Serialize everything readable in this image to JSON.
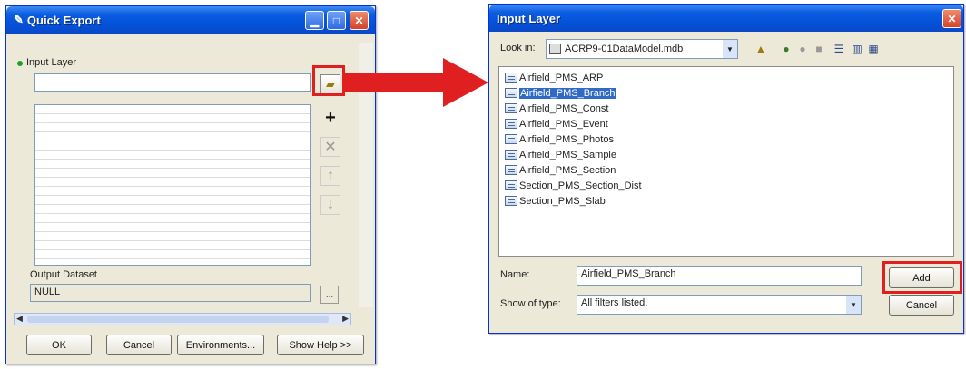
{
  "quick_export": {
    "title": "Quick Export",
    "input_layer_label": "Input Layer",
    "input_layer_value": "",
    "output_dataset_label": "Output Dataset",
    "output_dataset_value": "NULL",
    "buttons": {
      "ok": "OK",
      "cancel": "Cancel",
      "environments": "Environments...",
      "show_help": "Show Help >>"
    },
    "side_icons": {
      "browse": "folder-open-icon",
      "add": "plus-icon",
      "remove": "x-icon",
      "up": "arrow-up-icon",
      "down": "arrow-down-icon"
    }
  },
  "input_layer_dialog": {
    "title": "Input Layer",
    "look_in_label": "Look in:",
    "look_in_value": "ACRP9-01DataModel.mdb",
    "items": [
      "Airfield_PMS_ARP",
      "Airfield_PMS_Branch",
      "Airfield_PMS_Const",
      "Airfield_PMS_Event",
      "Airfield_PMS_Photos",
      "Airfield_PMS_Sample",
      "Airfield_PMS_Section",
      "Section_PMS_Section_Dist",
      "Section_PMS_Slab"
    ],
    "selected_item": "Airfield_PMS_Branch",
    "name_label": "Name:",
    "name_value": "Airfield_PMS_Branch",
    "show_type_label": "Show of type:",
    "show_type_value": "All filters listed.",
    "add_button": "Add",
    "cancel_button": "Cancel"
  },
  "colors": {
    "highlight": "#e02020",
    "title_bar": "#0a5ce0",
    "selection": "#316ac5",
    "window_bg": "#ece9d8"
  }
}
